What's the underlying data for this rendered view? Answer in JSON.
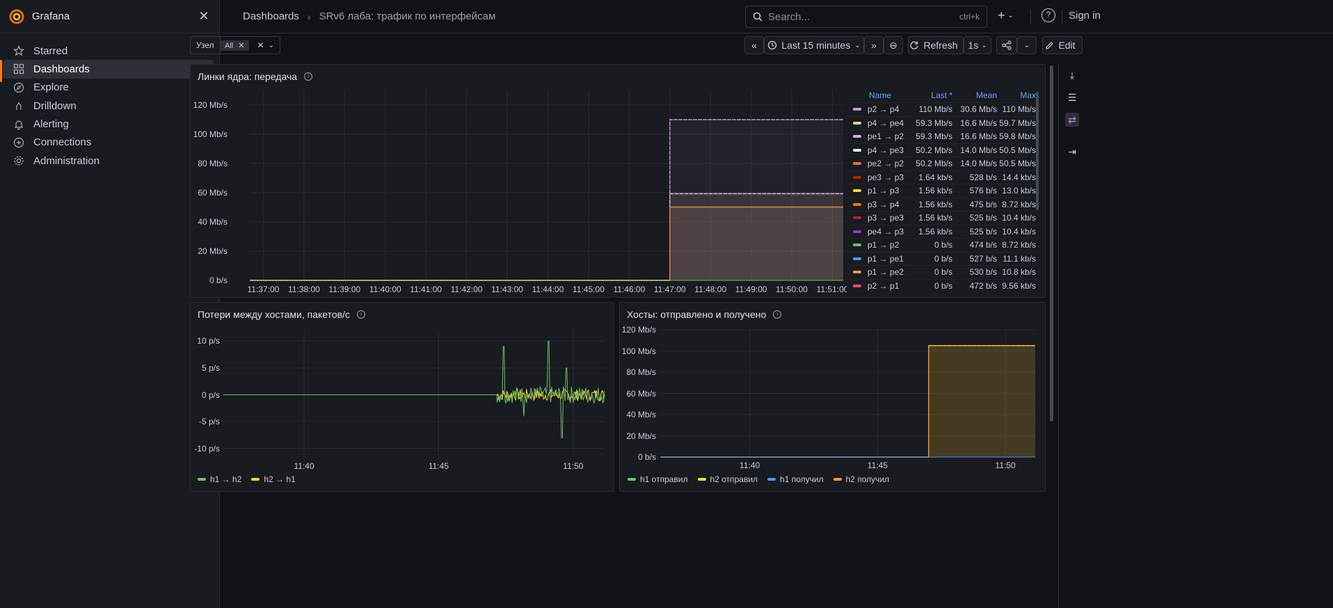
{
  "app": {
    "name": "Grafana",
    "close_glyph": "✕"
  },
  "nav": [
    {
      "label": "Starred",
      "icon": "star-icon",
      "chevron": true,
      "active": false
    },
    {
      "label": "Dashboards",
      "icon": "grid-icon",
      "chevron": true,
      "active": true
    },
    {
      "label": "Explore",
      "icon": "compass-icon",
      "chevron": false,
      "active": false
    },
    {
      "label": "Drilldown",
      "icon": "drilldown-icon",
      "chevron": true,
      "active": false
    },
    {
      "label": "Alerting",
      "icon": "bell-icon",
      "chevron": true,
      "active": false
    },
    {
      "label": "Connections",
      "icon": "connections-icon",
      "chevron": true,
      "active": false
    },
    {
      "label": "Administration",
      "icon": "gear-icon",
      "chevron": true,
      "active": false
    }
  ],
  "breadcrumb": {
    "root": "Dashboards",
    "separator": "›",
    "current": "SRv6 лаба: трафик по интерфейсам"
  },
  "search": {
    "placeholder": "Search...",
    "shortcut": "ctrl+k"
  },
  "topbar": {
    "plus": "+",
    "help": "?",
    "signin": "Sign in"
  },
  "variable": {
    "label": "Узел",
    "chip": "All",
    "chip_remove": "✕",
    "clear": "✕",
    "chevron": "⌄"
  },
  "toolbar": {
    "back": "«",
    "time_range": "Last 15 minutes",
    "forward": "»",
    "zoom": "⊖",
    "refresh": "Refresh",
    "interval": "1s",
    "edit": "Edit"
  },
  "panel1": {
    "title": "Линки ядра: передача",
    "y_ticks": [
      "120 Mb/s",
      "100 Mb/s",
      "80 Mb/s",
      "60 Mb/s",
      "40 Mb/s",
      "20 Mb/s",
      "0 b/s"
    ],
    "x_ticks": [
      "11:37:00",
      "11:38:00",
      "11:39:00",
      "11:40:00",
      "11:41:00",
      "11:42:00",
      "11:43:00",
      "11:44:00",
      "11:45:00",
      "11:46:00",
      "11:47:00",
      "11:48:00",
      "11:49:00",
      "11:50:00",
      "11:51:00"
    ],
    "legend_headers": {
      "name": "Name",
      "last": "Last *",
      "mean": "Mean",
      "max": "Max"
    },
    "legend": [
      {
        "name": "p2 → p4",
        "last": "110 Mb/s",
        "mean": "30.6 Mb/s",
        "max": "110 Mb/s",
        "color": "#ca95e5"
      },
      {
        "name": "p4 → pe4",
        "last": "59.3 Mb/s",
        "mean": "16.6 Mb/s",
        "max": "59.7 Mb/s",
        "color": "#ffcb7d"
      },
      {
        "name": "pe1 → p2",
        "last": "59.3 Mb/s",
        "mean": "16.6 Mb/s",
        "max": "59.8 Mb/s",
        "color": "#dea6f0"
      },
      {
        "name": "p4 → pe3",
        "last": "50.2 Mb/s",
        "mean": "14.0 Mb/s",
        "max": "50.5 Mb/s",
        "color": "#e8eefc"
      },
      {
        "name": "pe2 → p2",
        "last": "50.2 Mb/s",
        "mean": "14.0 Mb/s",
        "max": "50.5 Mb/s",
        "color": "#e0752d"
      },
      {
        "name": "pe3 → p3",
        "last": "1.64 kb/s",
        "mean": "528 b/s",
        "max": "14.4 kb/s",
        "color": "#bf1b00"
      },
      {
        "name": "p1 → p3",
        "last": "1.56 kb/s",
        "mean": "576 b/s",
        "max": "13.0 kb/s",
        "color": "#fade2a"
      },
      {
        "name": "p3 → p4",
        "last": "1.56 kb/s",
        "mean": "475 b/s",
        "max": "8.72 kb/s",
        "color": "#ff780a"
      },
      {
        "name": "p3 → pe3",
        "last": "1.56 kb/s",
        "mean": "525 b/s",
        "max": "10.4 kb/s",
        "color": "#c4162a"
      },
      {
        "name": "pe4 → p3",
        "last": "1.56 kb/s",
        "mean": "525 b/s",
        "max": "10.4 kb/s",
        "color": "#8f3bb8"
      },
      {
        "name": "p1 → p2",
        "last": "0 b/s",
        "mean": "474 b/s",
        "max": "8.72 kb/s",
        "color": "#73bf69"
      },
      {
        "name": "p1 → pe1",
        "last": "0 b/s",
        "mean": "527 b/s",
        "max": "11.1 kb/s",
        "color": "#5794f2"
      },
      {
        "name": "p1 → pe2",
        "last": "0 b/s",
        "mean": "530 b/s",
        "max": "10.8 kb/s",
        "color": "#ff9830"
      },
      {
        "name": "p2 → p1",
        "last": "0 b/s",
        "mean": "472 b/s",
        "max": "9.56 kb/s",
        "color": "#f2495c"
      }
    ]
  },
  "panel2": {
    "title": "Потери между хостами, пакетов/с",
    "y_ticks": [
      "10 p/s",
      "5 p/s",
      "0 p/s",
      "-5 p/s",
      "-10 p/s"
    ],
    "x_ticks": [
      "11:40",
      "11:45",
      "11:50"
    ],
    "legend": [
      {
        "name": "h1 → h2",
        "color": "#73bf69"
      },
      {
        "name": "h2 → h1",
        "color": "#fade2a"
      }
    ]
  },
  "panel3": {
    "title": "Хосты: отправлено и получено",
    "y_ticks": [
      "120 Mb/s",
      "100 Mb/s",
      "80 Mb/s",
      "60 Mb/s",
      "40 Mb/s",
      "20 Mb/s",
      "0 b/s"
    ],
    "x_ticks": [
      "11:40",
      "11:45",
      "11:50"
    ],
    "legend": [
      {
        "name": "h1 отправил",
        "color": "#73bf69"
      },
      {
        "name": "h2 отправил",
        "color": "#fade2a"
      },
      {
        "name": "h1 получил",
        "color": "#5794f2"
      },
      {
        "name": "h2 получил",
        "color": "#ff9830"
      }
    ]
  },
  "chart_data": [
    {
      "type": "area",
      "title": "Линки ядра: передача",
      "x_range": [
        "11:36:40",
        "11:51:20"
      ],
      "y_range": [
        0,
        130
      ],
      "y_unit": "Mb/s",
      "step_time": "11:47:00",
      "series": [
        {
          "name": "p2 → p4",
          "before": 0,
          "after": 110
        },
        {
          "name": "p4 → pe4",
          "before": 0,
          "after": 59.3
        },
        {
          "name": "pe1 → p2",
          "before": 0,
          "after": 59.3
        },
        {
          "name": "p4 → pe3",
          "before": 0,
          "after": 50.2
        },
        {
          "name": "pe2 → p2",
          "before": 0,
          "after": 50.2
        }
      ]
    },
    {
      "type": "line",
      "title": "Потери между хостами, пакетов/с",
      "x_range": [
        "11:37:00",
        "11:51:10"
      ],
      "y_range": [
        -12,
        12
      ],
      "noise_start": "11:47:10",
      "spikes": [
        {
          "time": "11:47:25",
          "value": 9
        },
        {
          "time": "11:48:10",
          "value": -4
        },
        {
          "time": "11:49:05",
          "value": 10
        },
        {
          "time": "11:49:35",
          "value": -8
        },
        {
          "time": "11:49:45",
          "value": 5
        }
      ]
    },
    {
      "type": "area",
      "title": "Хосты: отправлено и получено",
      "x_range": [
        "11:36:30",
        "11:51:10"
      ],
      "y_range": [
        0,
        120
      ],
      "y_unit": "Mb/s",
      "step_time": "11:47:00",
      "level_after": 105
    }
  ]
}
